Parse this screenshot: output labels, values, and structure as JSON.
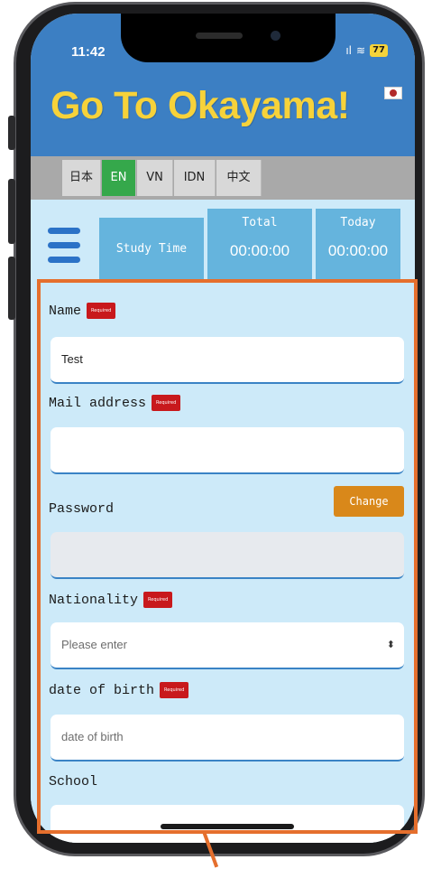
{
  "status_bar": {
    "time": "11:42",
    "signal": "ıl",
    "wifi": "≋",
    "battery": "77"
  },
  "header": {
    "title": "Go To Okayama!"
  },
  "languages": [
    {
      "label": "日本",
      "active": false
    },
    {
      "label": "EN",
      "active": true
    },
    {
      "label": "VN",
      "active": false
    },
    {
      "label": "IDN",
      "active": false
    },
    {
      "label": "中文",
      "active": false
    }
  ],
  "study": {
    "label": "Study Time",
    "total_label": "Total",
    "total_value": "00:00:00",
    "today_label": "Today",
    "today_value": "00:00:00"
  },
  "form": {
    "required_badge": "Required",
    "name": {
      "label": "Name",
      "value": "Test"
    },
    "mail": {
      "label": "Mail address",
      "value": ""
    },
    "password": {
      "label": "Password",
      "value": "",
      "change_button": "Change"
    },
    "nationality": {
      "label": "Nationality",
      "placeholder": "Please enter"
    },
    "dob": {
      "label": "date of birth",
      "placeholder": "date of birth"
    },
    "school": {
      "label": "School",
      "value": ""
    }
  },
  "colors": {
    "header_blue": "#3c7fc3",
    "title_yellow": "#f7d23a",
    "active_lang": "#35a84b",
    "required_red": "#c8191c",
    "change_orange": "#d9881a",
    "highlight": "#e56f2d"
  }
}
